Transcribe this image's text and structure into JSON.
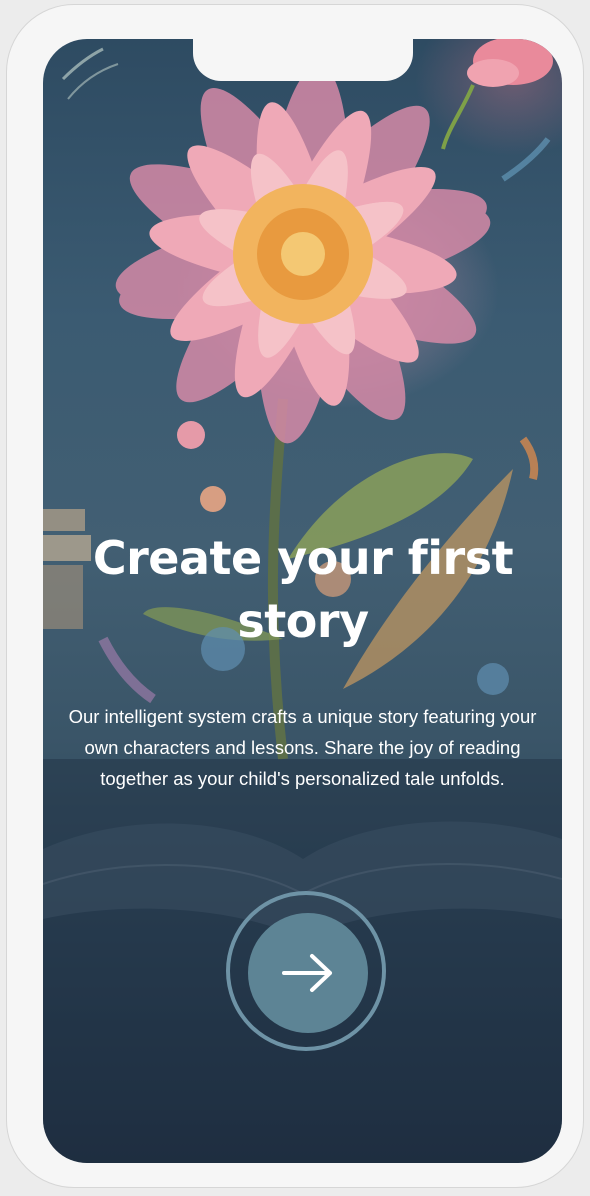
{
  "onboarding": {
    "title": "Create your first story",
    "description": "Our intelligent system crafts a unique story featuring your own characters and lessons. Share the joy of reading together as your child's personalized tale unfolds.",
    "next_icon": "arrow-right-icon",
    "background_art": "flower-over-open-book-illustration"
  },
  "colors": {
    "title_text": "#ffffff",
    "button_fill": "#5d8495",
    "button_ring": "#6e93a6",
    "screen_bottom": "#1e2e41"
  }
}
